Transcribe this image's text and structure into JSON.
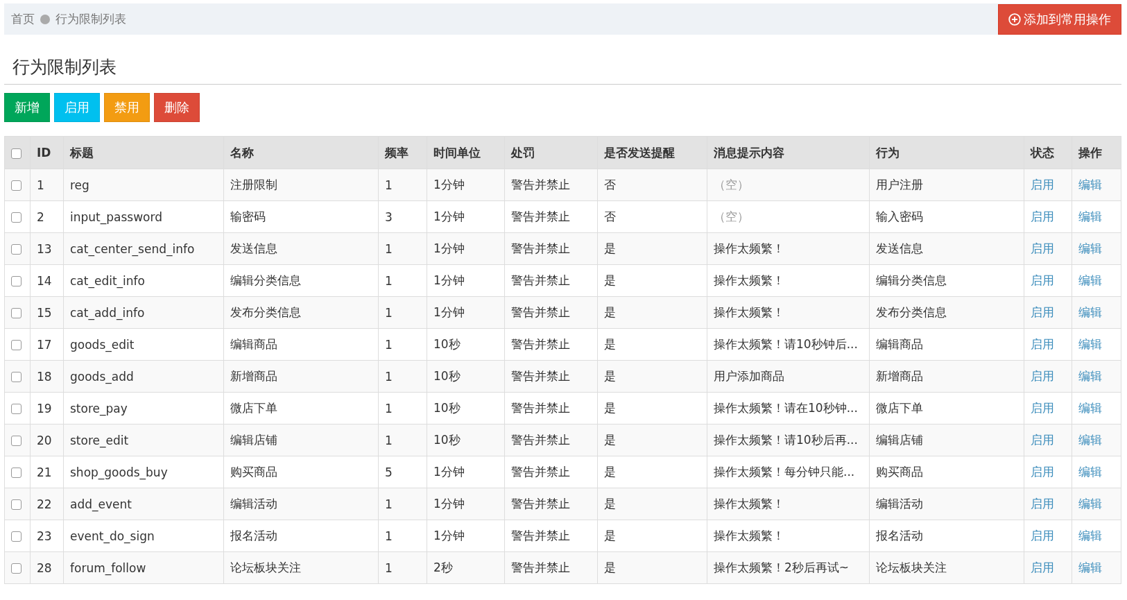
{
  "breadcrumb": [
    {
      "label": "首页"
    },
    {
      "label": "行为限制列表"
    }
  ],
  "add_shortcut_button": "添加到常用操作",
  "page_title": "行为限制列表",
  "toolbar": [
    {
      "label": "新增",
      "color": "#00a65a"
    },
    {
      "label": "启用",
      "color": "#00c0ef"
    },
    {
      "label": "禁用",
      "color": "#f39c12"
    },
    {
      "label": "删除",
      "color": "#dd4b39"
    }
  ],
  "table": {
    "select_all_checked": false,
    "columns": [
      "ID",
      "标题",
      "名称",
      "频率",
      "时间单位",
      "处罚",
      "是否发送提醒",
      "消息提示内容",
      "行为",
      "状态",
      "操作"
    ],
    "rows": [
      {
        "checked": false,
        "id": "1",
        "title": "reg",
        "name": "注册限制",
        "frequency": "1",
        "time_unit": "1分钟",
        "penalty": "警告并禁止",
        "send_reminder": "否",
        "message": "（空）",
        "message_empty": true,
        "action": "用户注册",
        "status": "启用",
        "operation": "编辑"
      },
      {
        "checked": false,
        "id": "2",
        "title": "input_password",
        "name": "输密码",
        "frequency": "3",
        "time_unit": "1分钟",
        "penalty": "警告并禁止",
        "send_reminder": "否",
        "message": "（空）",
        "message_empty": true,
        "action": "输入密码",
        "status": "启用",
        "operation": "编辑"
      },
      {
        "checked": false,
        "id": "13",
        "title": "cat_center_send_info",
        "name": "发送信息",
        "frequency": "1",
        "time_unit": "1分钟",
        "penalty": "警告并禁止",
        "send_reminder": "是",
        "message": "操作太频繁！",
        "message_empty": false,
        "action": "发送信息",
        "status": "启用",
        "operation": "编辑"
      },
      {
        "checked": false,
        "id": "14",
        "title": "cat_edit_info",
        "name": "编辑分类信息",
        "frequency": "1",
        "time_unit": "1分钟",
        "penalty": "警告并禁止",
        "send_reminder": "是",
        "message": "操作太频繁！",
        "message_empty": false,
        "action": "编辑分类信息",
        "status": "启用",
        "operation": "编辑"
      },
      {
        "checked": false,
        "id": "15",
        "title": "cat_add_info",
        "name": "发布分类信息",
        "frequency": "1",
        "time_unit": "1分钟",
        "penalty": "警告并禁止",
        "send_reminder": "是",
        "message": "操作太频繁！",
        "message_empty": false,
        "action": "发布分类信息",
        "status": "启用",
        "operation": "编辑"
      },
      {
        "checked": false,
        "id": "17",
        "title": "goods_edit",
        "name": "编辑商品",
        "frequency": "1",
        "time_unit": "10秒",
        "penalty": "警告并禁止",
        "send_reminder": "是",
        "message": "操作太频繁！请10秒钟后...",
        "message_empty": false,
        "action": "编辑商品",
        "status": "启用",
        "operation": "编辑"
      },
      {
        "checked": false,
        "id": "18",
        "title": "goods_add",
        "name": "新增商品",
        "frequency": "1",
        "time_unit": "10秒",
        "penalty": "警告并禁止",
        "send_reminder": "是",
        "message": "用户添加商品",
        "message_empty": false,
        "action": "新增商品",
        "status": "启用",
        "operation": "编辑"
      },
      {
        "checked": false,
        "id": "19",
        "title": "store_pay",
        "name": "微店下单",
        "frequency": "1",
        "time_unit": "10秒",
        "penalty": "警告并禁止",
        "send_reminder": "是",
        "message": "操作太频繁！请在10秒钟...",
        "message_empty": false,
        "action": "微店下单",
        "status": "启用",
        "operation": "编辑"
      },
      {
        "checked": false,
        "id": "20",
        "title": "store_edit",
        "name": "编辑店铺",
        "frequency": "1",
        "time_unit": "10秒",
        "penalty": "警告并禁止",
        "send_reminder": "是",
        "message": "操作太频繁！请10秒后再...",
        "message_empty": false,
        "action": "编辑店铺",
        "status": "启用",
        "operation": "编辑"
      },
      {
        "checked": false,
        "id": "21",
        "title": "shop_goods_buy",
        "name": "购买商品",
        "frequency": "5",
        "time_unit": "1分钟",
        "penalty": "警告并禁止",
        "send_reminder": "是",
        "message": "操作太频繁！每分钟只能...",
        "message_empty": false,
        "action": "购买商品",
        "status": "启用",
        "operation": "编辑"
      },
      {
        "checked": false,
        "id": "22",
        "title": "add_event",
        "name": "编辑活动",
        "frequency": "1",
        "time_unit": "1分钟",
        "penalty": "警告并禁止",
        "send_reminder": "是",
        "message": "操作太频繁！",
        "message_empty": false,
        "action": "编辑活动",
        "status": "启用",
        "operation": "编辑"
      },
      {
        "checked": false,
        "id": "23",
        "title": "event_do_sign",
        "name": "报名活动",
        "frequency": "1",
        "time_unit": "1分钟",
        "penalty": "警告并禁止",
        "send_reminder": "是",
        "message": "操作太频繁！",
        "message_empty": false,
        "action": "报名活动",
        "status": "启用",
        "operation": "编辑"
      },
      {
        "checked": false,
        "id": "28",
        "title": "forum_follow",
        "name": "论坛板块关注",
        "frequency": "1",
        "time_unit": "2秒",
        "penalty": "警告并禁止",
        "send_reminder": "是",
        "message": "操作太频繁！2秒后再试~",
        "message_empty": false,
        "action": "论坛板块关注",
        "status": "启用",
        "operation": "编辑"
      }
    ]
  }
}
